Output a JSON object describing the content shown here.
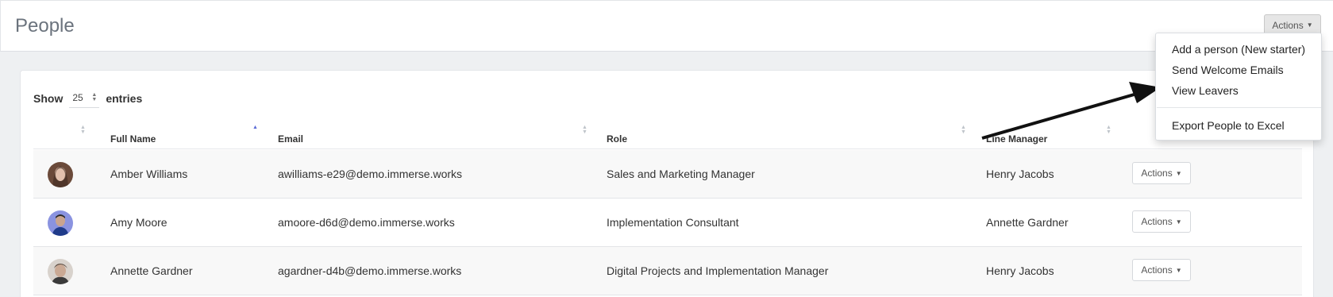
{
  "header": {
    "title": "People",
    "actions_label": "Actions"
  },
  "table_controls": {
    "show_label": "Show",
    "entries_value": "25",
    "entries_label": "entries"
  },
  "columns": {
    "full_name": "Full Name",
    "email": "Email",
    "role": "Role",
    "line_manager": "Line Manager"
  },
  "rows": [
    {
      "name": "Amber Williams",
      "email": "awilliams-e29@demo.immerse.works",
      "role": "Sales and Marketing Manager",
      "manager": "Henry Jacobs",
      "actions": "Actions"
    },
    {
      "name": "Amy Moore",
      "email": "amoore-d6d@demo.immerse.works",
      "role": "Implementation Consultant",
      "manager": "Annette Gardner",
      "actions": "Actions"
    },
    {
      "name": "Annette Gardner",
      "email": "agardner-d4b@demo.immerse.works",
      "role": "Digital Projects and Implementation Manager",
      "manager": "Henry Jacobs",
      "actions": "Actions"
    }
  ],
  "actions_menu": {
    "items": [
      "Add a person (New starter)",
      "Send Welcome Emails",
      "View Leavers",
      "Export People to Excel"
    ]
  },
  "colors": {
    "sort_active": "#5b6bd6",
    "row_stripe": "#f8f8f8",
    "background": "#eef0f2"
  }
}
